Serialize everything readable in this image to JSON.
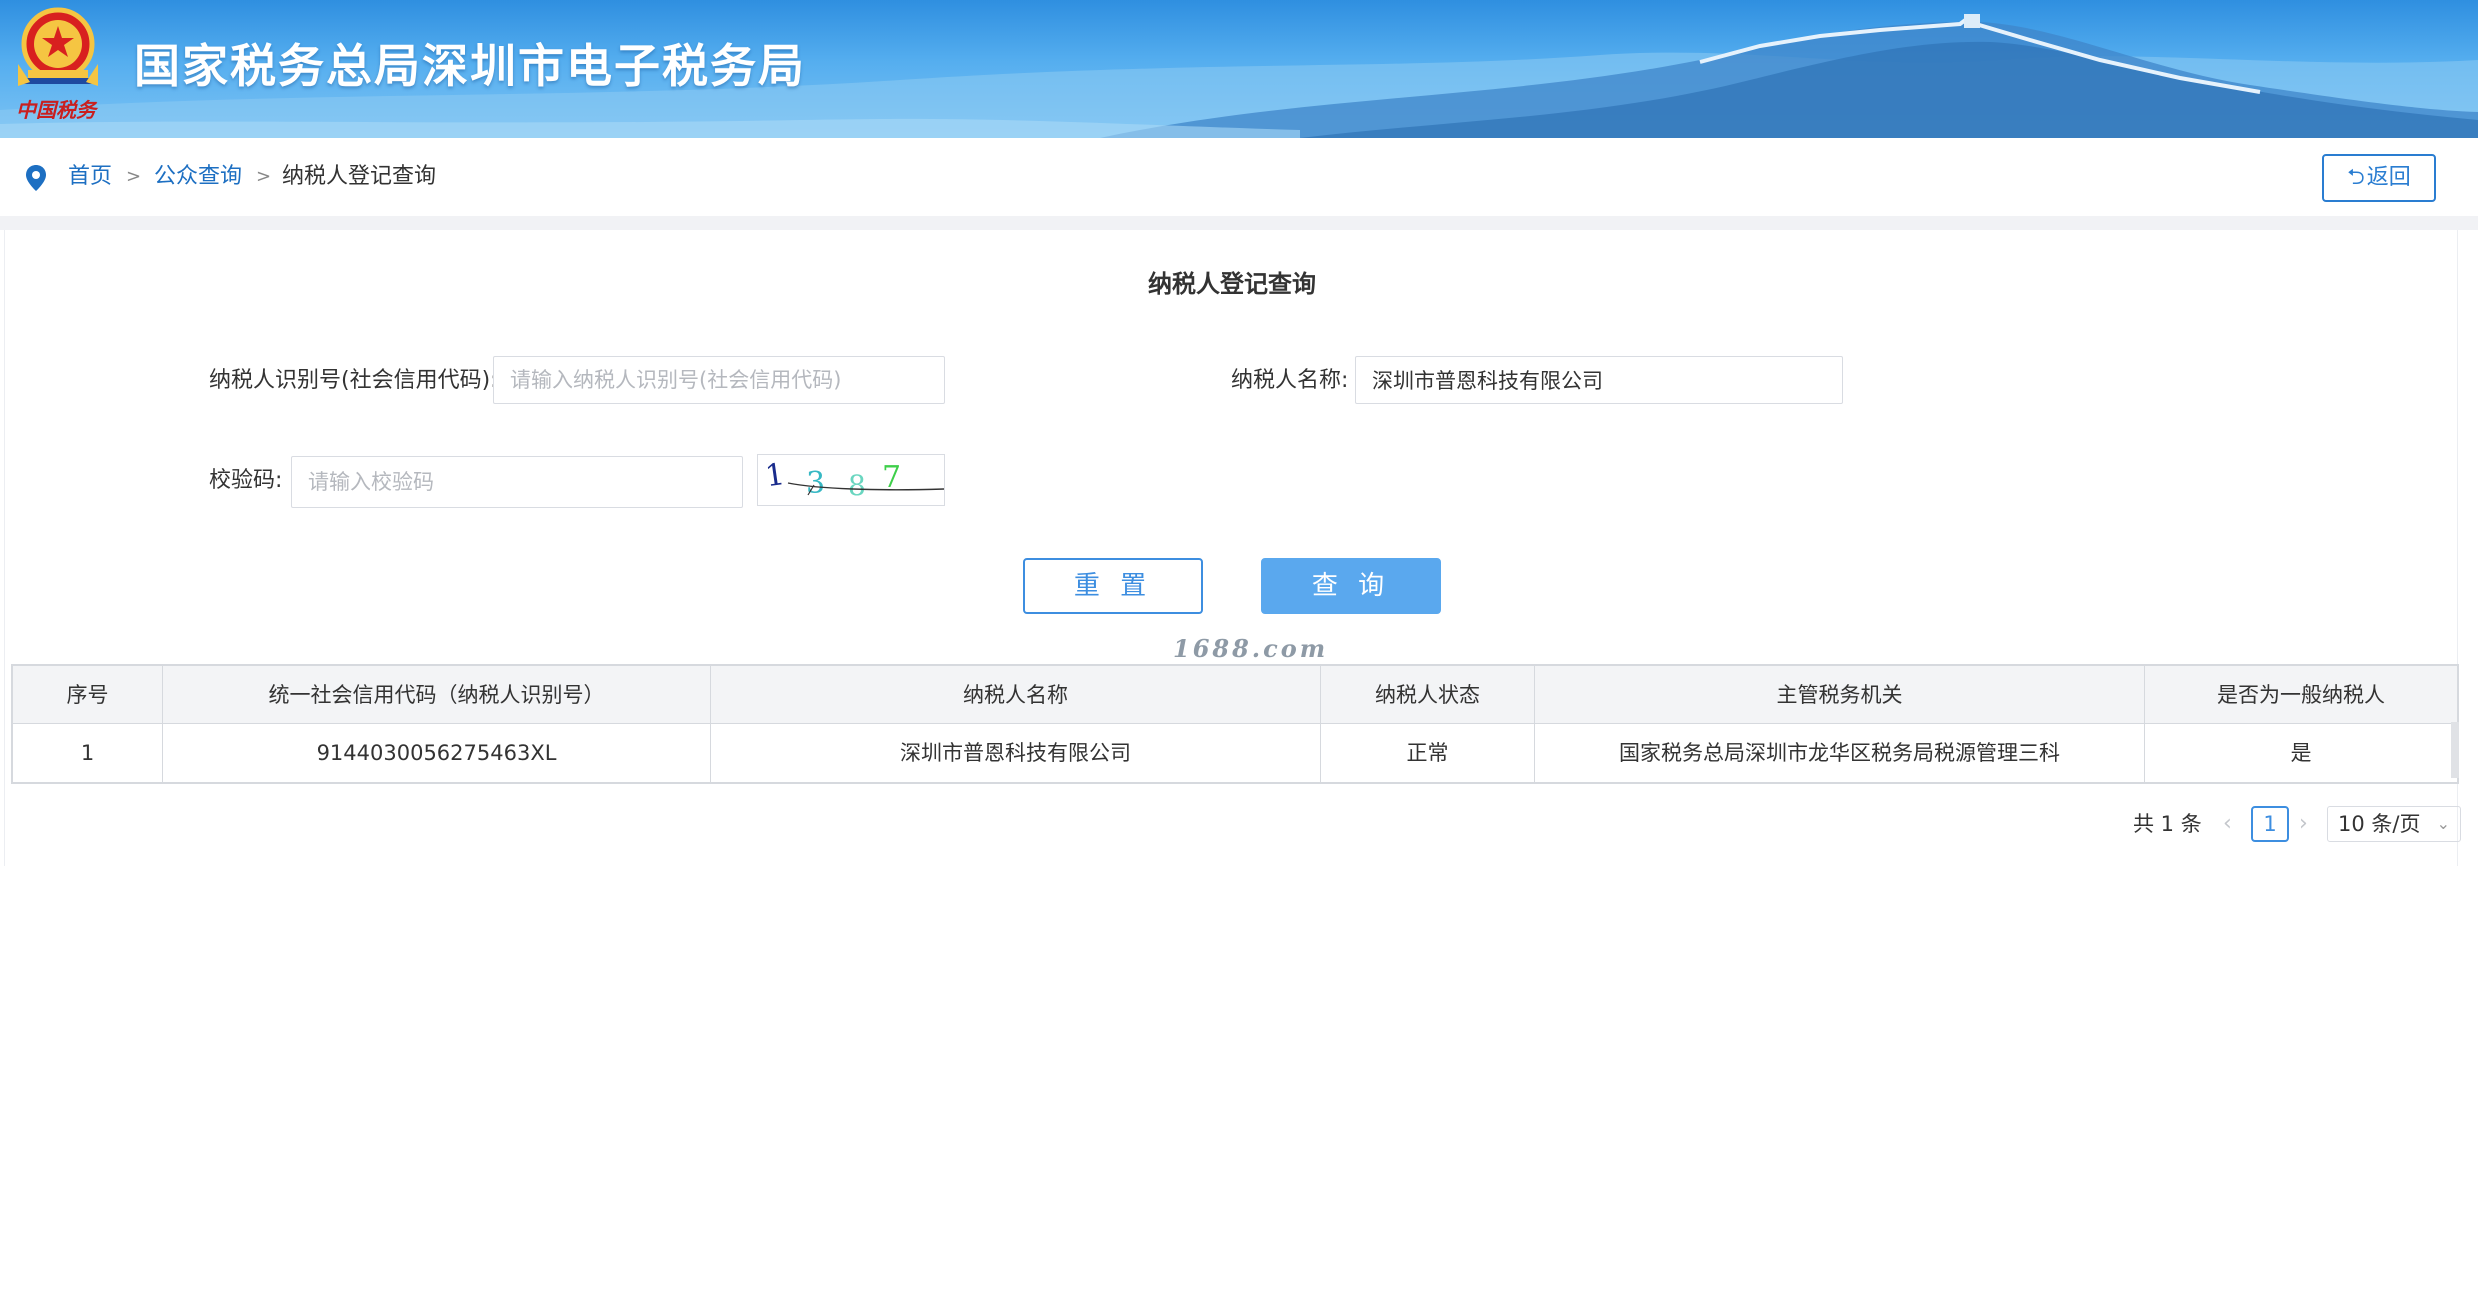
{
  "header": {
    "title": "国家税务总局深圳市电子税务局",
    "emblem_caption": "中国税务"
  },
  "breadcrumb": {
    "items": [
      {
        "label": "首页"
      },
      {
        "label": "公众查询"
      },
      {
        "label": "纳税人登记查询"
      }
    ],
    "separator": ">",
    "back_label": "返回"
  },
  "form": {
    "title": "纳税人登记查询",
    "taxpayer_id": {
      "label": "纳税人识别号(社会信用代码):",
      "value": "",
      "placeholder": "请输入纳税人识别号(社会信用代码)"
    },
    "taxpayer_name": {
      "label": "纳税人名称:",
      "value": "深圳市普恩科技有限公司",
      "placeholder": ""
    },
    "captcha": {
      "label": "校验码:",
      "value": "",
      "placeholder": "请输入校验码",
      "image_text": "1387"
    },
    "reset_label": "重 置",
    "query_label": "查 询"
  },
  "watermark": "1688.com",
  "table": {
    "columns": [
      "序号",
      "统一社会信用代码（纳税人识别号）",
      "纳税人名称",
      "纳税人状态",
      "主管税务机关",
      "是否为一般纳税人"
    ],
    "rows": [
      [
        "1",
        "9144030056275463XL",
        "深圳市普恩科技有限公司",
        "正常",
        "国家税务总局深圳市龙华区税务局税源管理三科",
        "是"
      ]
    ]
  },
  "pagination": {
    "total_text": "共 1 条",
    "current_page": "1",
    "page_size": "10 条/页"
  },
  "colors": {
    "primary": "#3d8ee0",
    "banner": "#55aeef",
    "query_button": "#5aa8ee"
  }
}
